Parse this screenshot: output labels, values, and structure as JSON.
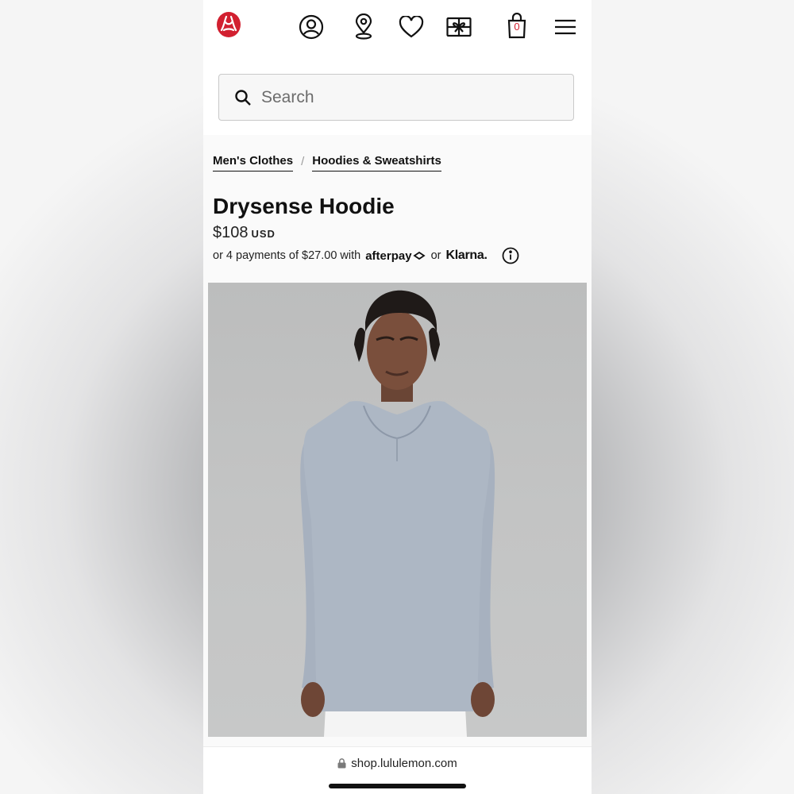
{
  "header": {
    "icons": [
      "lululemon-logo",
      "account-icon",
      "store-locator-icon",
      "wishlist-heart-icon",
      "gift-card-icon",
      "shopping-bag-icon",
      "menu-icon"
    ],
    "bag_count": "0",
    "brand_color": "#d22030"
  },
  "search": {
    "placeholder": "Search"
  },
  "breadcrumb": {
    "items": [
      "Men's Clothes",
      "Hoodies & Sweatshirts"
    ],
    "separator": "/"
  },
  "product": {
    "name": "Drysense Hoodie",
    "price": "$108",
    "currency": "USD",
    "installments": {
      "prefix": "or 4 payments of $27.00 with",
      "afterpay": "afterpay",
      "or": "or",
      "klarna": "Klarna."
    },
    "image_alt": "Model wearing a heather grey long-sleeve hoodie",
    "garment_color": "#a9b3c0"
  },
  "browser": {
    "url": "shop.lululemon.com"
  }
}
